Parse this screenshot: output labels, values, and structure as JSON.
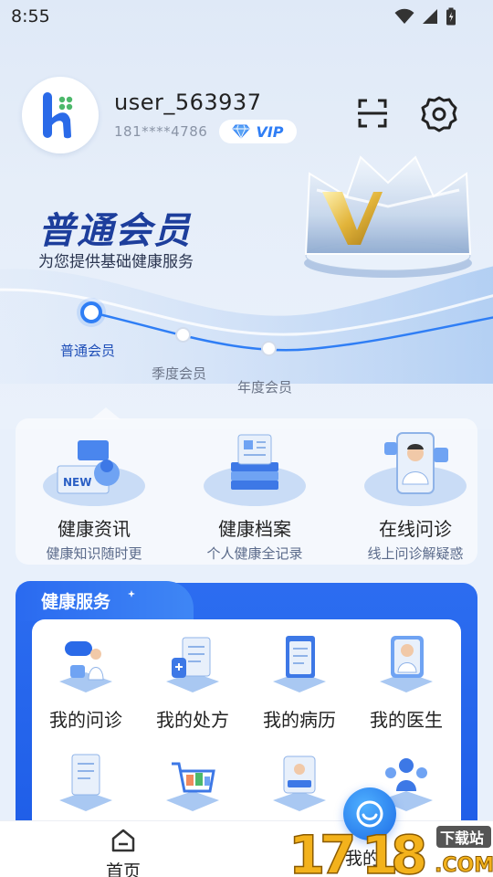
{
  "status_bar": {
    "time": "8:55"
  },
  "profile": {
    "username": "user_563937",
    "phone": "181****4786",
    "vip_label": "VIP"
  },
  "membership": {
    "title": "普通会员",
    "subtitle": "为您提供基础健康服务",
    "tiers": [
      {
        "label": "普通会员",
        "active": true
      },
      {
        "label": "季度会员",
        "active": false
      },
      {
        "label": "年度会员",
        "active": false
      }
    ]
  },
  "features": [
    {
      "title": "健康资讯",
      "subtitle": "健康知识随时更",
      "icon": "newspaper-icon"
    },
    {
      "title": "健康档案",
      "subtitle": "个人健康全记录",
      "icon": "archive-icon"
    },
    {
      "title": "在线问诊",
      "subtitle": "线上问诊解疑惑",
      "icon": "doctor-phone-icon"
    }
  ],
  "health_services": {
    "title": "健康服务",
    "items": [
      {
        "label": "我的问诊",
        "icon": "consultation-icon"
      },
      {
        "label": "我的处方",
        "icon": "prescription-icon"
      },
      {
        "label": "我的病历",
        "icon": "medical-record-icon"
      },
      {
        "label": "我的医生",
        "icon": "doctor-icon"
      },
      {
        "label": "",
        "icon": "report-icon"
      },
      {
        "label": "",
        "icon": "cart-icon"
      },
      {
        "label": "",
        "icon": "id-card-icon"
      },
      {
        "label": "",
        "icon": "family-icon"
      }
    ]
  },
  "bottom_nav": {
    "home_label": "首页",
    "me_label": "我的"
  },
  "colors": {
    "accent": "#2c6df0",
    "title": "#1d3e9c",
    "active_tier": "#2f7ef5"
  }
}
